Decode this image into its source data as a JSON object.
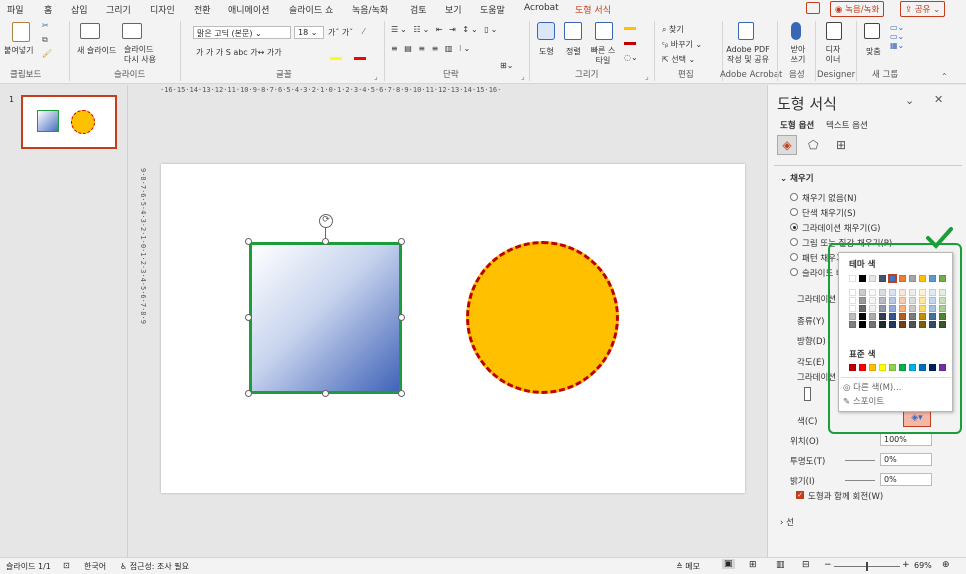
{
  "tabs": [
    "파일",
    "홈",
    "삽입",
    "그리기",
    "디자인",
    "전환",
    "애니메이션",
    "슬라이드 쇼",
    "녹음/녹화",
    "검토",
    "보기",
    "도움말",
    "Acrobat",
    "도형 서식"
  ],
  "right_buttons": {
    "record": "녹음/녹화",
    "share": "공유"
  },
  "ribbon": {
    "groups": [
      "클립보드",
      "슬라이드",
      "글꼴",
      "단락",
      "그리기",
      "편집",
      "Adobe Acrobat",
      "음성",
      "Designer",
      "새 그룹"
    ],
    "paste": "붙여넣기",
    "new_slide": "새 슬라이드",
    "slide_reuse": "슬라이드 다시 사용",
    "font_name": "맑은 고딕 (본문)",
    "font_size": "18",
    "shape": "도형",
    "arrange": "정렬",
    "quick_style": "빠른 스타일",
    "find": "찾기",
    "replace": "바꾸기",
    "select": "선택",
    "adobe_pdf": "Adobe PDF 작성 및 공유",
    "dictate": "받아 쓰기",
    "designer": "디자 이너",
    "fit": "맞춤"
  },
  "thumb_number": "1",
  "ruler_h": "·16·15·14·13·12·11·10·9·8·7·6·5·4·3·2·1·0·1·2·3·4·5·6·7·8·9·10·11·12·13·14·15·16·",
  "ruler_v": "9·8·7·6·5·4·3·2·1·0·1·2·3·4·5·6·7·8·9",
  "pane": {
    "title": "도형 서식",
    "tab_shape": "도형 옵션",
    "tab_text": "텍스트 옵션",
    "fill_section": "채우기",
    "fill_options": [
      "채우기 없음(N)",
      "단색 채우기(S)",
      "그라데이션 채우기(G)",
      "그림 또는 질감 채우기(P)",
      "패턴 채우기(A)",
      "슬라이드 배경 채우기(B)"
    ],
    "fill_selected_index": 2,
    "gradient_preset": "그라데이션",
    "type": "종류(Y)",
    "direction": "방향(D)",
    "angle": "각도(E)",
    "gradient_stops": "그라데이션",
    "color": "색(C)",
    "position": "위치(O)",
    "position_value": "100%",
    "transparency": "투명도(T)",
    "transparency_value": "0%",
    "brightness": "밝기(I)",
    "brightness_value": "0%",
    "rotate_with_shape": "도형과 함께 회전(W)",
    "line_section": "선"
  },
  "color_popup": {
    "theme_label": "테마 색",
    "standard_label": "표준 색",
    "more_colors": "다른 색(M)...",
    "eyedropper": "스포이트",
    "theme_colors": [
      "#ffffff",
      "#000000",
      "#e7e6e6",
      "#44546a",
      "#4472c4",
      "#ed7d31",
      "#a5a5a5",
      "#ffc000",
      "#5b9bd5",
      "#70ad47"
    ],
    "standard_colors": [
      "#c00000",
      "#ff0000",
      "#ffc000",
      "#ffff00",
      "#92d050",
      "#00b050",
      "#00b0f0",
      "#0070c0",
      "#002060",
      "#7030a0"
    ]
  },
  "status": {
    "slide": "슬라이드 1/1",
    "lang": "한국어",
    "access": "접근성: 조사 필요",
    "notes": "메모",
    "zoom": "69%"
  },
  "colors": {
    "accent": "#c43e1c",
    "highlight_green": "#1a9e3a",
    "circle_fill": "#ffc000",
    "circle_border": "#c00000"
  }
}
